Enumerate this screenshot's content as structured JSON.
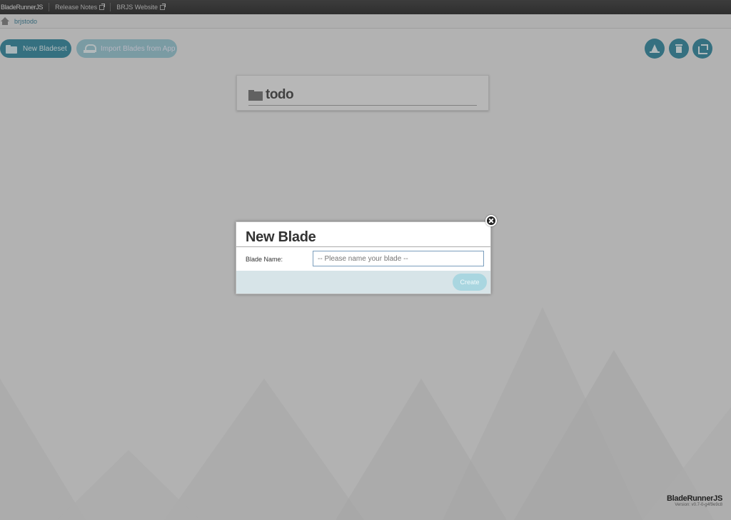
{
  "topbar": {
    "brand": "BladeRunnerJS",
    "links": [
      "Release Notes",
      "BRJS Website"
    ]
  },
  "breadcrumb": {
    "app": "brjstodo"
  },
  "toolbar": {
    "new_bladeset": "New Bladeset",
    "import_blades": "Import Blades from App"
  },
  "icons": {
    "action_buttons": [
      "cone-icon",
      "trash-icon",
      "share-icon"
    ]
  },
  "bladeset": {
    "name": "todo"
  },
  "modal": {
    "title": "New Blade",
    "field_label": "Blade Name:",
    "field_placeholder": "-- Please name your blade --",
    "field_value": "",
    "create_label": "Create"
  },
  "footer": {
    "brand": "BladeRunnerJS",
    "version": "Version: v0.7-0-g4f9e9c8"
  },
  "colors": {
    "accent": "#1f7f98",
    "accent_light": "#a9d6e0",
    "footer_bg": "#d7e4e8"
  }
}
